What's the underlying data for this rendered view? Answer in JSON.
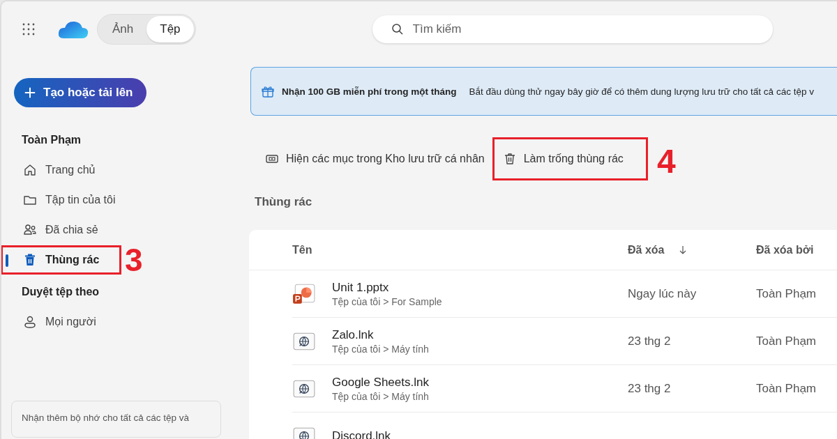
{
  "header": {
    "view_tabs": [
      {
        "label": "Ảnh",
        "selected": false
      },
      {
        "label": "Tệp",
        "selected": true
      }
    ],
    "search": {
      "placeholder": "Tìm kiếm"
    }
  },
  "sidebar": {
    "create_button": "Tạo hoặc tải lên",
    "sections": [
      {
        "title": "Toàn Phạm",
        "items": [
          {
            "kind": "home",
            "label": "Trang chủ",
            "selected": false
          },
          {
            "kind": "folder",
            "label": "Tập tin của tôi",
            "selected": false
          },
          {
            "kind": "shared",
            "label": "Đã chia sẻ",
            "selected": false
          },
          {
            "kind": "trash",
            "label": "Thùng rác",
            "selected": true,
            "callout": "3"
          }
        ]
      },
      {
        "title": "Duyệt tệp theo",
        "items": [
          {
            "kind": "person",
            "label": "Mọi người",
            "selected": false
          }
        ]
      }
    ],
    "storage_promo": "Nhận thêm bộ nhớ cho tất cả các tệp và"
  },
  "banner": {
    "title": "Nhận 100 GB miễn phí trong một tháng",
    "text": "Bắt đầu dùng thử ngay bây giờ để có thêm dung lượng lưu trữ cho tất cả các tệp v"
  },
  "toolbar": [
    {
      "kind": "vault",
      "label": "Hiện các mục trong Kho lưu trữ cá nhân"
    },
    {
      "kind": "trash",
      "label": "Làm trống thùng rác",
      "callout": "4"
    }
  ],
  "page_title": "Thùng rác",
  "table": {
    "columns": [
      {
        "label": "Tên",
        "sorted": false
      },
      {
        "label": "Đã xóa",
        "sorted": true
      },
      {
        "label": "Đã xóa bởi",
        "sorted": false
      }
    ],
    "rows": [
      {
        "kind": "pptx",
        "name": "Unit 1.pptx",
        "path": "Tệp của tôi > For Sample",
        "deleted": "Ngay lúc này",
        "deleted_by": "Toàn Phạm"
      },
      {
        "kind": "link",
        "name": "Zalo.lnk",
        "path": "Tệp của tôi > Máy tính",
        "deleted": "23 thg 2",
        "deleted_by": "Toàn Phạm"
      },
      {
        "kind": "link",
        "name": "Google Sheets.lnk",
        "path": "Tệp của tôi > Máy tính",
        "deleted": "23 thg 2",
        "deleted_by": "Toàn Phạm"
      },
      {
        "kind": "link",
        "name": "Discord.lnk"
      }
    ]
  }
}
